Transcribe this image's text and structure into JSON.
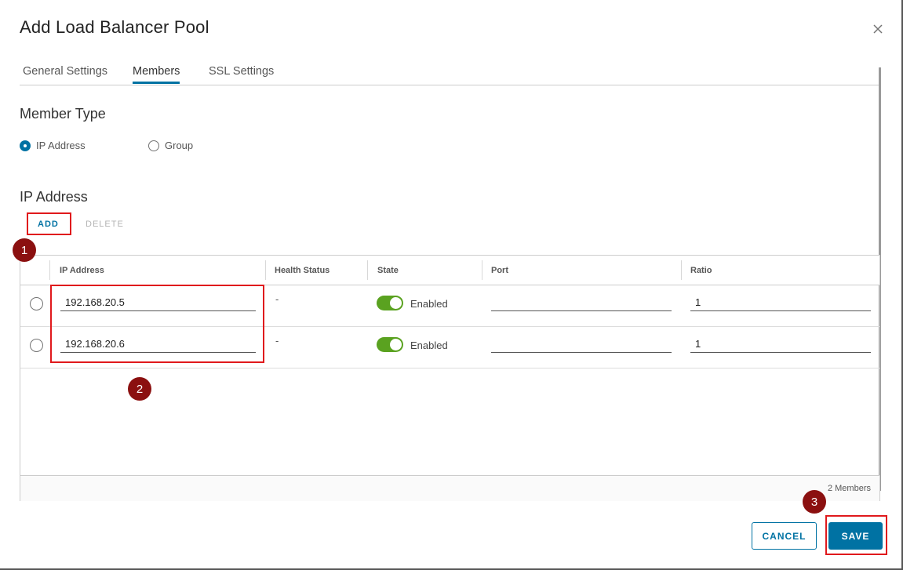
{
  "dialog": {
    "title": "Add Load Balancer Pool"
  },
  "tabs": [
    {
      "label": "General Settings"
    },
    {
      "label": "Members",
      "active": true
    },
    {
      "label": "SSL Settings"
    }
  ],
  "member_type": {
    "title": "Member Type",
    "options": [
      {
        "label": "IP Address",
        "selected": true
      },
      {
        "label": "Group",
        "selected": false
      }
    ]
  },
  "ip_section": {
    "title": "IP Address",
    "add_label": "ADD",
    "delete_label": "DELETE"
  },
  "table": {
    "columns": [
      "IP Address",
      "Health Status",
      "State",
      "Port",
      "Ratio"
    ],
    "rows": [
      {
        "ip": "192.168.20.5",
        "health": "-",
        "state": "Enabled",
        "port": "",
        "ratio": "1"
      },
      {
        "ip": "192.168.20.6",
        "health": "-",
        "state": "Enabled",
        "port": "",
        "ratio": "1"
      }
    ],
    "footer": "2 Members"
  },
  "actions": {
    "cancel_label": "CANCEL",
    "save_label": "SAVE"
  },
  "callouts": [
    "1",
    "2",
    "3"
  ],
  "colors": {
    "accent": "#0072a3",
    "toggle_on": "#5aa220",
    "highlight": "#e0191c",
    "badge": "#8b1010"
  }
}
